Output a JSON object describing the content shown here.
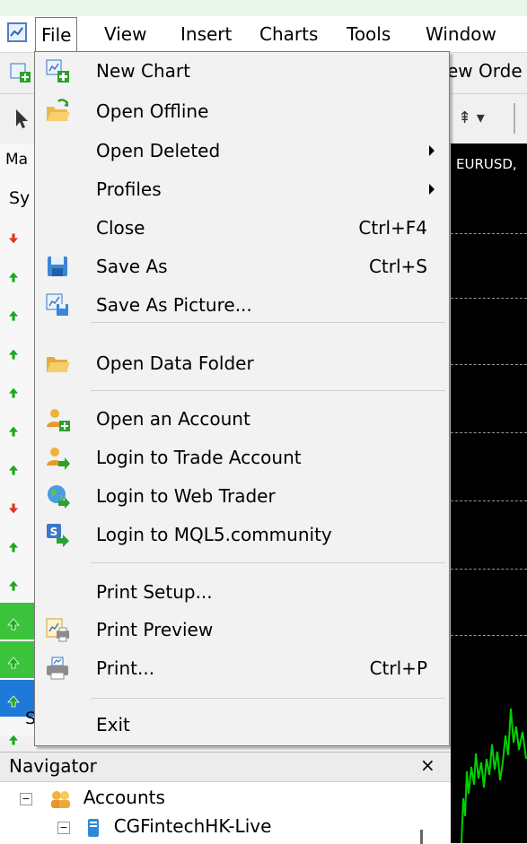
{
  "menubar": {
    "items": [
      "File",
      "View",
      "Insert",
      "Charts",
      "Tools",
      "Window"
    ],
    "active": "File"
  },
  "toolbar": {
    "new_order_label": "ew Orde"
  },
  "market_watch": {
    "header": "Ma",
    "column": "Sy",
    "tab_label": "S",
    "arrows": [
      "down",
      "up",
      "up",
      "up",
      "up",
      "up",
      "up",
      "down",
      "up",
      "up",
      "up",
      "up",
      "up",
      "up"
    ]
  },
  "chart": {
    "symbol": "EURUSD,"
  },
  "file_menu": {
    "items": [
      {
        "label": "New Chart",
        "icon": "new-chart-icon",
        "shortcut": "",
        "submenu": false
      },
      {
        "label": "Open Offline",
        "icon": "open-offline-icon",
        "shortcut": "",
        "submenu": false
      },
      {
        "label": "Open Deleted",
        "icon": "",
        "shortcut": "",
        "submenu": true
      },
      {
        "label": "Profiles",
        "icon": "",
        "shortcut": "",
        "submenu": true
      },
      {
        "label": "Close",
        "icon": "",
        "shortcut": "Ctrl+F4",
        "submenu": false
      },
      {
        "label": "Save As",
        "icon": "save-icon",
        "shortcut": "Ctrl+S",
        "submenu": false
      },
      {
        "label": "Save As Picture...",
        "icon": "save-picture-icon",
        "shortcut": "",
        "submenu": false
      },
      {
        "label": "Open Data Folder",
        "icon": "folder-icon",
        "shortcut": "",
        "submenu": false
      },
      {
        "label": "Open an Account",
        "icon": "add-user-icon",
        "shortcut": "",
        "submenu": false
      },
      {
        "label": "Login to Trade Account",
        "icon": "login-user-icon",
        "shortcut": "",
        "submenu": false
      },
      {
        "label": "Login to Web Trader",
        "icon": "web-trader-icon",
        "shortcut": "",
        "submenu": false
      },
      {
        "label": "Login to MQL5.community",
        "icon": "mql5-icon",
        "shortcut": "",
        "submenu": false
      },
      {
        "label": "Print Setup...",
        "icon": "",
        "shortcut": "",
        "submenu": false
      },
      {
        "label": "Print Preview",
        "icon": "print-preview-icon",
        "shortcut": "",
        "submenu": false
      },
      {
        "label": "Print...",
        "icon": "printer-icon",
        "shortcut": "Ctrl+P",
        "submenu": false
      },
      {
        "label": "Exit",
        "icon": "",
        "shortcut": "",
        "submenu": false
      }
    ]
  },
  "navigator": {
    "title": "Navigator",
    "close_glyph": "×",
    "accounts_label": "Accounts",
    "server_label": "CGFintechHK-Live"
  },
  "colors": {
    "up_arrow": "#1ea81e",
    "down_arrow": "#d93a1e",
    "chart_bg": "#000000",
    "candle": "#00d000",
    "menu_bg": "#f2f2f2"
  }
}
